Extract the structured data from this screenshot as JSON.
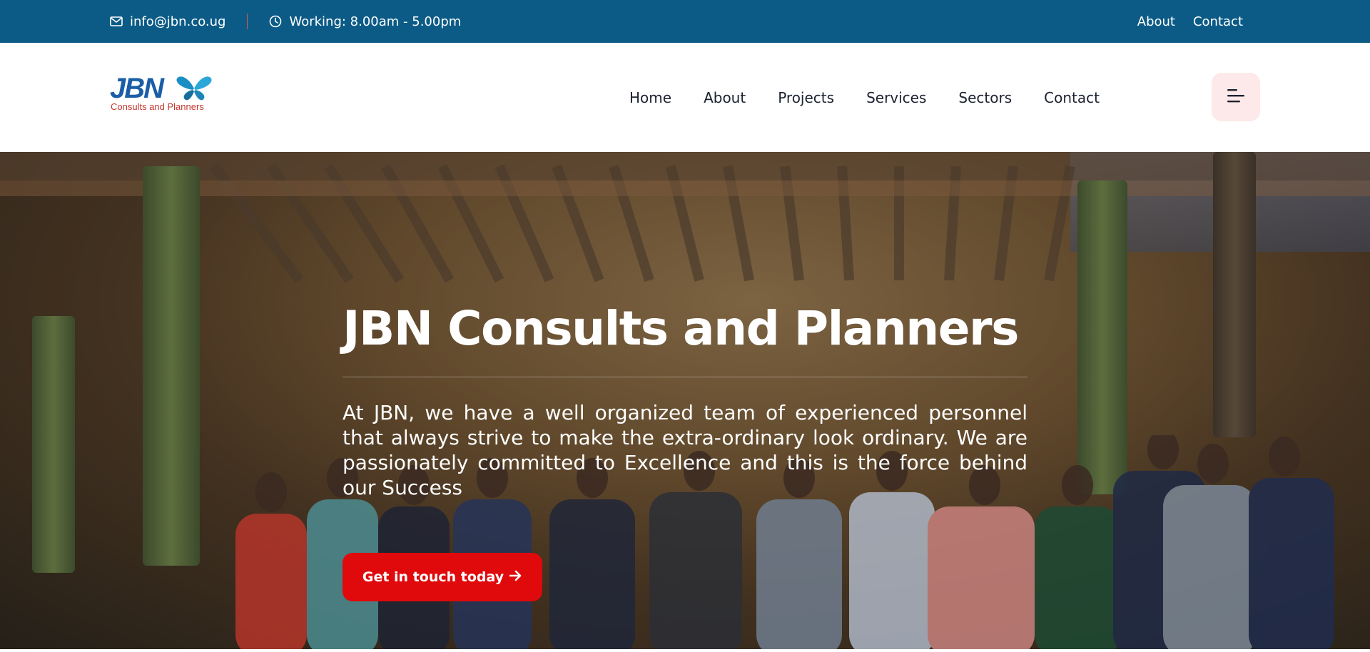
{
  "topbar": {
    "email": "info@jbn.co.ug",
    "hours": "Working: 8.00am - 5.00pm",
    "links": [
      "About",
      "Contact"
    ]
  },
  "logo": {
    "mark": "JBN",
    "subtitle": "Consults and Planners"
  },
  "nav": {
    "items": [
      "Home",
      "About",
      "Projects",
      "Services",
      "Sectors",
      "Contact"
    ]
  },
  "hero": {
    "title": "JBN Consults and Planners",
    "text": "At JBN, we have a well organized team of experienced personnel that always strive to make the extra-ordinary look ordinary. We are passionately committed to Excellence and this is the force behind our Success",
    "cta_label": "Get in touch today"
  },
  "colors": {
    "topbar_bg": "#0b5b86",
    "accent_red": "#e0090b",
    "logo_blue": "#1b5ea6",
    "logo_red": "#c4372f",
    "menu_button_bg": "#fde9e9"
  },
  "icons": [
    "envelope-icon",
    "clock-icon",
    "butterfly-logo-icon",
    "hamburger-menu-icon",
    "arrow-right-icon"
  ]
}
